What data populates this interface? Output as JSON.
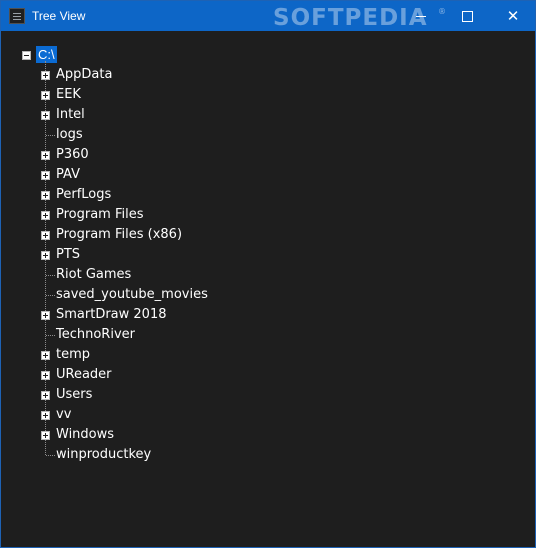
{
  "window": {
    "title": "Tree View",
    "watermark": "SOFTPEDIA",
    "watermark_mark": "®",
    "accent_color": "#0d66c7",
    "background_color": "#1e1e1e"
  },
  "title_controls": {
    "minimize": "minimize-icon",
    "maximize": "maximize-icon",
    "close": "✕"
  },
  "tree": {
    "root": {
      "label": "C:\\",
      "expanded": true,
      "selected": true
    },
    "children": [
      {
        "label": "AppData",
        "has_children": true
      },
      {
        "label": "EEK",
        "has_children": true
      },
      {
        "label": "Intel",
        "has_children": true
      },
      {
        "label": "logs",
        "has_children": false
      },
      {
        "label": "P360",
        "has_children": true
      },
      {
        "label": "PAV",
        "has_children": true
      },
      {
        "label": "PerfLogs",
        "has_children": true
      },
      {
        "label": "Program Files",
        "has_children": true
      },
      {
        "label": "Program Files (x86)",
        "has_children": true
      },
      {
        "label": "PTS",
        "has_children": true
      },
      {
        "label": "Riot Games",
        "has_children": false
      },
      {
        "label": "saved_youtube_movies",
        "has_children": false
      },
      {
        "label": "SmartDraw 2018",
        "has_children": true
      },
      {
        "label": "TechnoRiver",
        "has_children": false
      },
      {
        "label": "temp",
        "has_children": true
      },
      {
        "label": "UReader",
        "has_children": true
      },
      {
        "label": "Users",
        "has_children": true
      },
      {
        "label": "vv",
        "has_children": true
      },
      {
        "label": "Windows",
        "has_children": true
      },
      {
        "label": "winproductkey",
        "has_children": false
      }
    ]
  }
}
